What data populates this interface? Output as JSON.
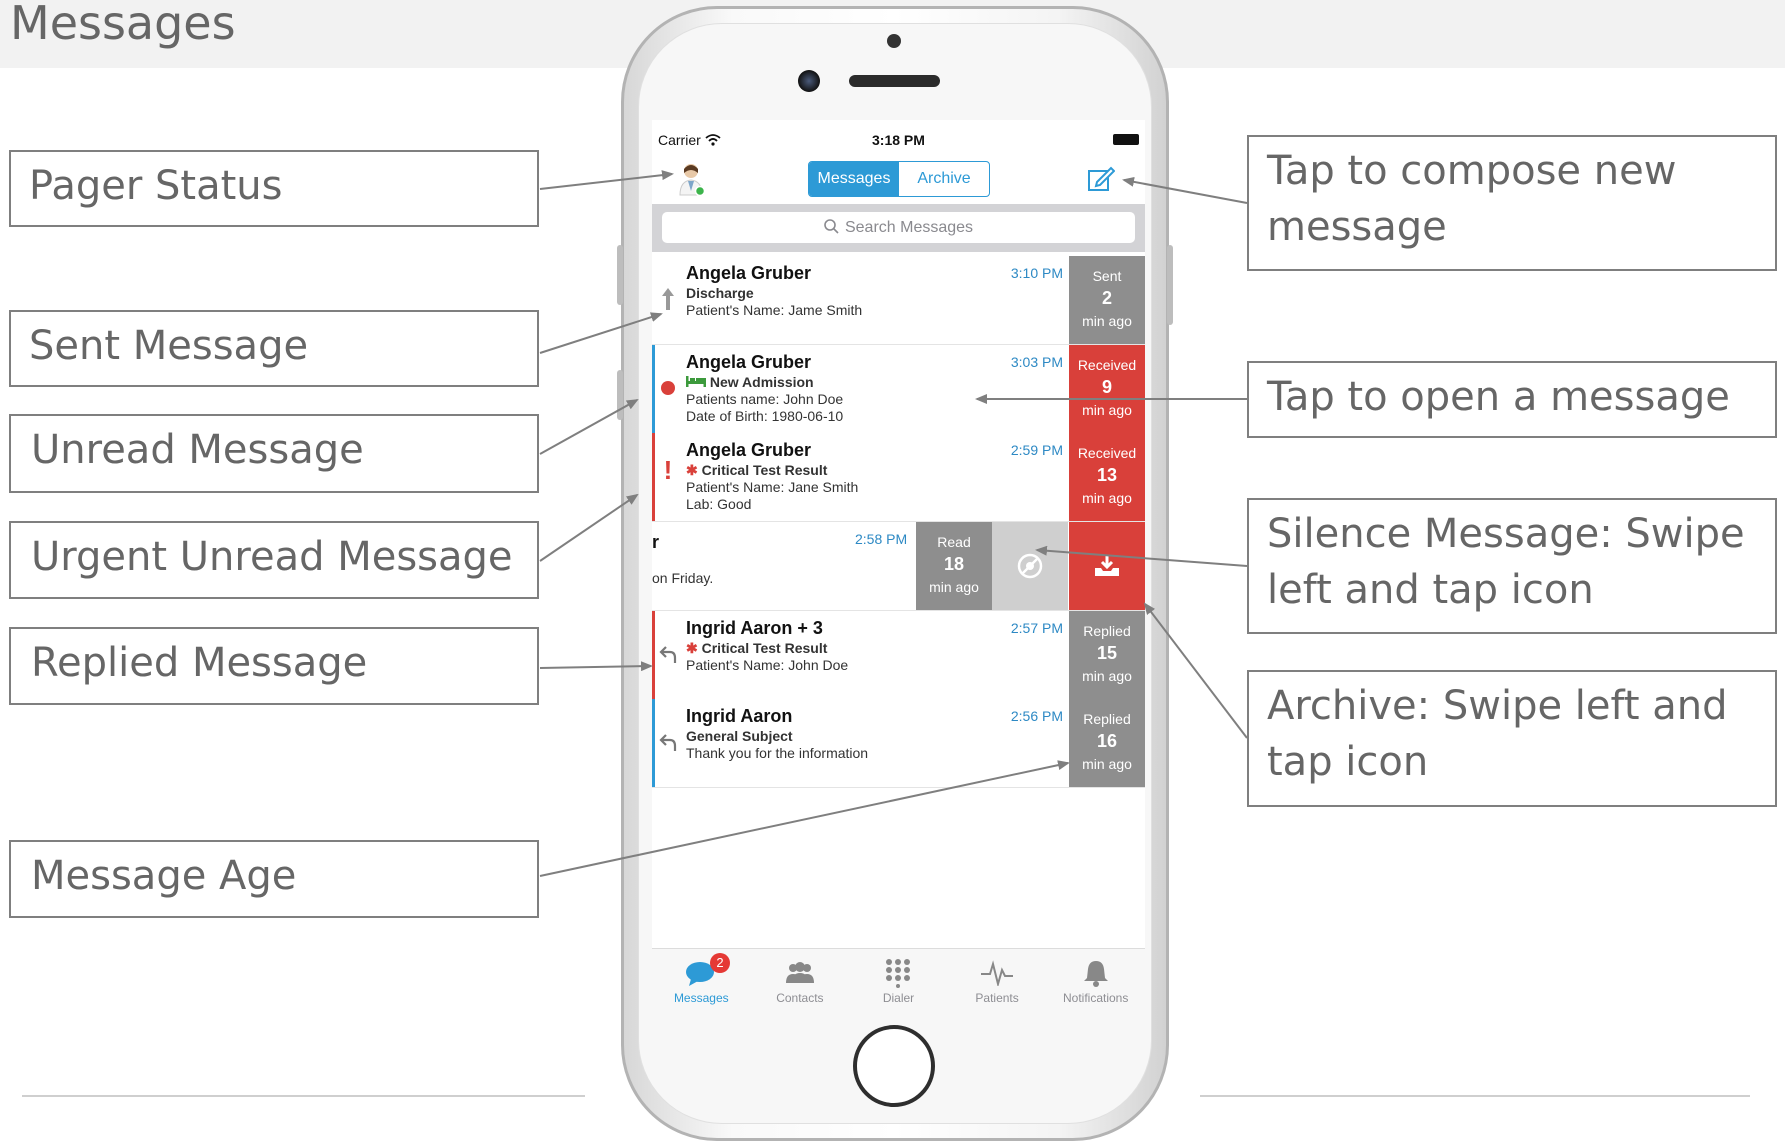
{
  "slide": {
    "title": "Messages"
  },
  "callouts": {
    "pager_status": "Pager Status",
    "sent_message": "Sent Message",
    "unread_message": "Unread Message",
    "urgent_unread_message": "Urgent Unread Message",
    "replied_message": "Replied Message",
    "message_age": "Message Age",
    "compose_new": "Tap to compose new message",
    "open_message": "Tap to open a message",
    "silence_message": "Silence Message: Swipe left and tap icon",
    "archive": "Archive: Swipe left and tap icon"
  },
  "status_bar": {
    "carrier": "Carrier",
    "time": "3:18 PM"
  },
  "nav": {
    "tab_messages": "Messages",
    "tab_archive": "Archive"
  },
  "search": {
    "placeholder": "Search Messages"
  },
  "messages": [
    {
      "sender": "Angela Gruber",
      "subject": "Discharge",
      "line1": "Patient's Name: Jame Smith",
      "line2": "",
      "time": "3:10 PM",
      "age_status": "Sent",
      "age_value": "2",
      "age_unit": "min ago",
      "icon": "sent-arrow-icon"
    },
    {
      "sender": "Angela Gruber",
      "subject": "New Admission",
      "line1": "Patients name: John Doe",
      "line2": "Date of Birth: 1980-06-10",
      "time": "3:03 PM",
      "age_status": "Received",
      "age_value": "9",
      "age_unit": "min ago",
      "icon": "unread-dot-icon"
    },
    {
      "sender": "Angela Gruber",
      "subject": "Critical Test Result",
      "line1": "Patient's Name: Jane Smith",
      "line2": "Lab: Good",
      "time": "2:59 PM",
      "age_status": "Received",
      "age_value": "13",
      "age_unit": "min ago",
      "icon": "urgent-exclamation-icon"
    },
    {
      "sender": "r",
      "subject": "",
      "line1": "on Friday.",
      "line2": "",
      "time": "2:58 PM",
      "age_status": "Read",
      "age_value": "18",
      "age_unit": "min ago",
      "icon": ""
    },
    {
      "sender": "Ingrid Aaron + 3",
      "subject": "Critical Test Result",
      "line1": "Patient's Name: John Doe",
      "line2": "",
      "time": "2:57 PM",
      "age_status": "Replied",
      "age_value": "15",
      "age_unit": "min ago",
      "icon": "reply-arrow-icon"
    },
    {
      "sender": "Ingrid Aaron",
      "subject": "General Subject",
      "line1": "Thank you for the information",
      "line2": "",
      "time": "2:56 PM",
      "age_status": "Replied",
      "age_value": "16",
      "age_unit": "min ago",
      "icon": "reply-arrow-icon"
    }
  ],
  "tabbar": [
    {
      "label": "Messages",
      "icon": "chat-bubble-icon",
      "badge": "2"
    },
    {
      "label": "Contacts",
      "icon": "contacts-icon"
    },
    {
      "label": "Dialer",
      "icon": "dialpad-icon"
    },
    {
      "label": "Patients",
      "icon": "heartbeat-icon"
    },
    {
      "label": "Notifications",
      "icon": "bell-icon"
    }
  ],
  "colors": {
    "accent": "#2d9ad6",
    "received": "#d9403a",
    "age_gray": "#8e8e8e",
    "unread_bar": "#2d9ad6",
    "urgent_bar": "#d9403a"
  }
}
